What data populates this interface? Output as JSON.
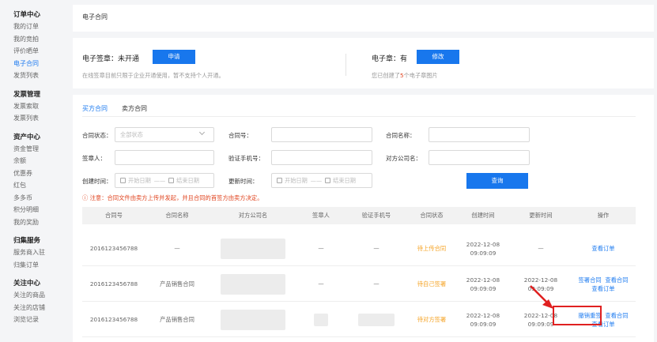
{
  "sidebar": {
    "groups": [
      {
        "title": "订单中心",
        "items": [
          "我的订单",
          "我的竞拍",
          "评价晒单",
          "电子合同",
          "发货列表"
        ]
      },
      {
        "title": "发票管理",
        "items": [
          "发票索取",
          "发票列表"
        ]
      },
      {
        "title": "资产中心",
        "items": [
          "资金管理",
          "余额",
          "优惠券",
          "红包",
          "多多币",
          "积分明细",
          "我的奖励"
        ]
      },
      {
        "title": "归集服务",
        "items": [
          "服务商入驻",
          "归集订单"
        ]
      },
      {
        "title": "关注中心",
        "items": [
          "关注的商品",
          "关注的店铺",
          "浏览记录"
        ]
      }
    ],
    "active": "电子合同"
  },
  "breadcrumb": "电子合同",
  "signature": {
    "label": "电子签章：未开通",
    "apply_button": "申请",
    "note": "在线签章目前只限于企业开通使用，暂不支持个人开通。",
    "seal_label": "电子章：有",
    "modify_button": "修改",
    "seal_note_prefix": "您已创建了",
    "seal_count": "5",
    "seal_note_suffix": "个电子章图片"
  },
  "tabs": [
    "买方合同",
    "卖方合同"
  ],
  "filters": {
    "status_label": "合同状态：",
    "status_placeholder": "全部状态",
    "number_label": "合同号：",
    "name_label": "合同名称：",
    "signer_label": "签章人：",
    "phone_label": "验证手机号：",
    "company_label": "对方公司名：",
    "created_label": "创建时间：",
    "updated_label": "更新时间：",
    "start_date": "开始日期",
    "end_date": "结束日期",
    "dash": "——",
    "query_button": "查询"
  },
  "notice": "ⓘ 注意：合同文件由卖方上传并发起，并且合同的首签方由卖方决定。",
  "table": {
    "headers": [
      "合同号",
      "合同名称",
      "对方公司名",
      "签章人",
      "验证手机号",
      "合同状态",
      "创建时间",
      "更新时间",
      "操作"
    ],
    "rows": [
      {
        "number": "2016123456788",
        "name": "—",
        "signer": "—",
        "phone": "—",
        "status": "待上传合同",
        "created_date": "2022-12-08",
        "created_time": "09:09:09",
        "updated_date": "—",
        "updated_time": "",
        "ops": [
          "查看订单"
        ]
      },
      {
        "number": "2016123456788",
        "name": "产品销售合同",
        "signer": "—",
        "phone": "—",
        "status": "待自己签署",
        "created_date": "2022-12-08",
        "created_time": "09:09:09",
        "updated_date": "2022-12-08",
        "updated_time": "09:09:09",
        "ops": [
          "签署合同",
          "查看合同",
          "查看订单"
        ]
      },
      {
        "number": "2016123456788",
        "name": "产品销售合同",
        "signer": "",
        "phone": "",
        "status": "待对方签署",
        "created_date": "2022-12-08",
        "created_time": "09:09:09",
        "updated_date": "2022-12-08",
        "updated_time": "09:09:09",
        "ops": [
          "撤销重签",
          "查看合同",
          "查看订单"
        ]
      }
    ]
  },
  "colors": {
    "accent": "#1f7cf0",
    "warning": "#f5a324",
    "alert": "#e0431e",
    "highlight": "#e02020"
  }
}
